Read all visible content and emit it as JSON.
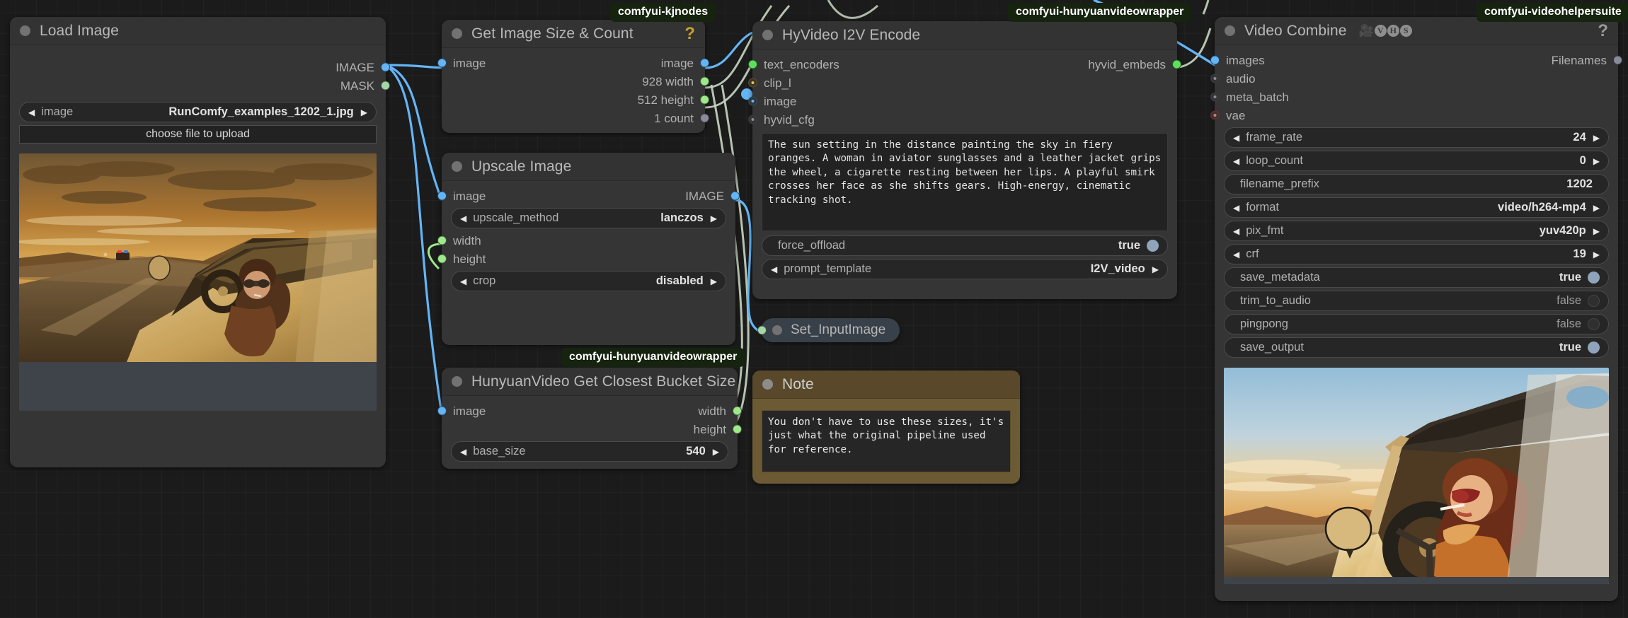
{
  "badges": [
    {
      "id": "kjnodes",
      "label": "comfyui-kjnodes"
    },
    {
      "id": "hunyuan1",
      "label": "comfyui-hunyuanvideowrapper"
    },
    {
      "id": "hunyuan2",
      "label": "comfyui-hunyuanvideowrapper"
    },
    {
      "id": "videohelper",
      "label": "comfyui-videohelpersuite"
    }
  ],
  "load_image": {
    "title": "Load Image",
    "outputs": [
      {
        "label": "IMAGE",
        "type": "image"
      },
      {
        "label": "MASK",
        "type": "mask"
      }
    ],
    "image_widget": {
      "name": "image",
      "value": "RunComfy_examples_1202_1.jpg"
    },
    "upload_button": "choose file to upload"
  },
  "get_image_size": {
    "title": "Get Image Size & Count",
    "help": "?",
    "inputs": [
      {
        "label": "image",
        "type": "image"
      }
    ],
    "outputs": [
      {
        "label": "image",
        "type": "image"
      },
      {
        "label": "928 width",
        "type": "int"
      },
      {
        "label": "512 height",
        "type": "int"
      },
      {
        "label": "1 count",
        "type": "grey"
      }
    ]
  },
  "upscale_image": {
    "title": "Upscale Image",
    "inputs": [
      {
        "label": "image",
        "type": "image"
      },
      {
        "label": "width",
        "type": "int"
      },
      {
        "label": "height",
        "type": "int"
      }
    ],
    "outputs": [
      {
        "label": "IMAGE",
        "type": "image"
      }
    ],
    "widgets": [
      {
        "name": "upscale_method",
        "value": "lanczos",
        "kind": "combo"
      },
      {
        "name": "crop",
        "value": "disabled",
        "kind": "combo"
      }
    ]
  },
  "bucket_size": {
    "title": "HunyuanVideo Get Closest Bucket Size",
    "inputs": [
      {
        "label": "image",
        "type": "image"
      }
    ],
    "outputs": [
      {
        "label": "width",
        "type": "int"
      },
      {
        "label": "height",
        "type": "int"
      }
    ],
    "widgets": [
      {
        "name": "base_size",
        "value": "540",
        "kind": "number"
      }
    ]
  },
  "i2v_encode": {
    "title": "HyVideo I2V Encode",
    "inputs": [
      {
        "label": "text_encoders",
        "type": "green"
      },
      {
        "label": "clip_l",
        "type": "clip"
      },
      {
        "label": "image",
        "type": "image"
      },
      {
        "label": "hyvid_cfg",
        "type": "grey"
      }
    ],
    "outputs": [
      {
        "label": "hyvid_embeds",
        "type": "green"
      }
    ],
    "prompt": "The sun setting in the distance painting the sky in fiery oranges. A woman in aviator sunglasses and a leather jacket grips the wheel, a cigarette resting between her lips. A playful smirk crosses her face as she shifts gears. High-energy, cinematic tracking shot.",
    "widgets": [
      {
        "name": "force_offload",
        "value": "true",
        "kind": "toggle",
        "on": true
      },
      {
        "name": "prompt_template",
        "value": "I2V_video",
        "kind": "combo"
      }
    ]
  },
  "set_input_image": {
    "title": "Set_InputImage"
  },
  "note": {
    "title": "Note",
    "text": "You don't have to use these sizes, it's just what the original pipeline used for reference."
  },
  "video_combine": {
    "title": "Video Combine",
    "icon_camera": "🎥",
    "icon_letters": [
      "V",
      "H",
      "S"
    ],
    "help": "?",
    "inputs": [
      {
        "label": "images",
        "type": "image"
      },
      {
        "label": "audio",
        "type": "grey"
      },
      {
        "label": "meta_batch",
        "type": "grey"
      },
      {
        "label": "vae",
        "type": "vae"
      }
    ],
    "outputs": [
      {
        "label": "Filenames",
        "type": "grey"
      }
    ],
    "widgets": [
      {
        "name": "frame_rate",
        "value": "24",
        "kind": "number"
      },
      {
        "name": "loop_count",
        "value": "0",
        "kind": "number"
      },
      {
        "name": "filename_prefix",
        "value": "1202",
        "kind": "text"
      },
      {
        "name": "format",
        "value": "video/h264-mp4",
        "kind": "combo"
      },
      {
        "name": "pix_fmt",
        "value": "yuv420p",
        "kind": "combo"
      },
      {
        "name": "crf",
        "value": "19",
        "kind": "number"
      },
      {
        "name": "save_metadata",
        "value": "true",
        "kind": "toggle",
        "on": true
      },
      {
        "name": "trim_to_audio",
        "value": "false",
        "kind": "toggle",
        "on": false
      },
      {
        "name": "pingpong",
        "value": "false",
        "kind": "toggle",
        "on": false
      },
      {
        "name": "save_output",
        "value": "true",
        "kind": "toggle",
        "on": true
      }
    ]
  }
}
